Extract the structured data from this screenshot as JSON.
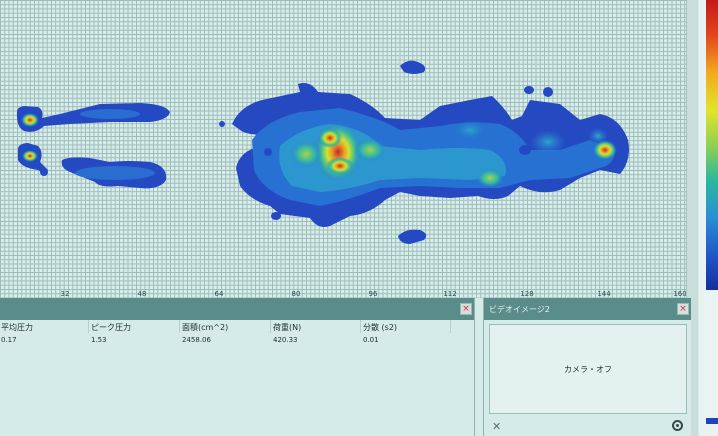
{
  "heatmap": {
    "x_ticks": [
      "32",
      "48",
      "64",
      "80",
      "96",
      "112",
      "128",
      "144",
      "160"
    ],
    "color_scale": [
      "#c41a1a",
      "#e2451b",
      "#f2a91f",
      "#e3e32b",
      "#8fd14f",
      "#29b99d",
      "#2a8ed6",
      "#2056c6",
      "#152f9f"
    ]
  },
  "data_panel": {
    "close_label": "×",
    "headers": [
      "平均圧力",
      "ピーク圧力",
      "面積(cm^2)",
      "荷重(N)",
      "分散 (s2)"
    ],
    "values": [
      "0.17",
      "1.53",
      "2458.06",
      "420.33",
      "0.01"
    ]
  },
  "video_panel": {
    "title": "ビデオイメージ2",
    "close_label": "×",
    "camera_status": "カメラ・オフ",
    "x_label": "✕"
  }
}
